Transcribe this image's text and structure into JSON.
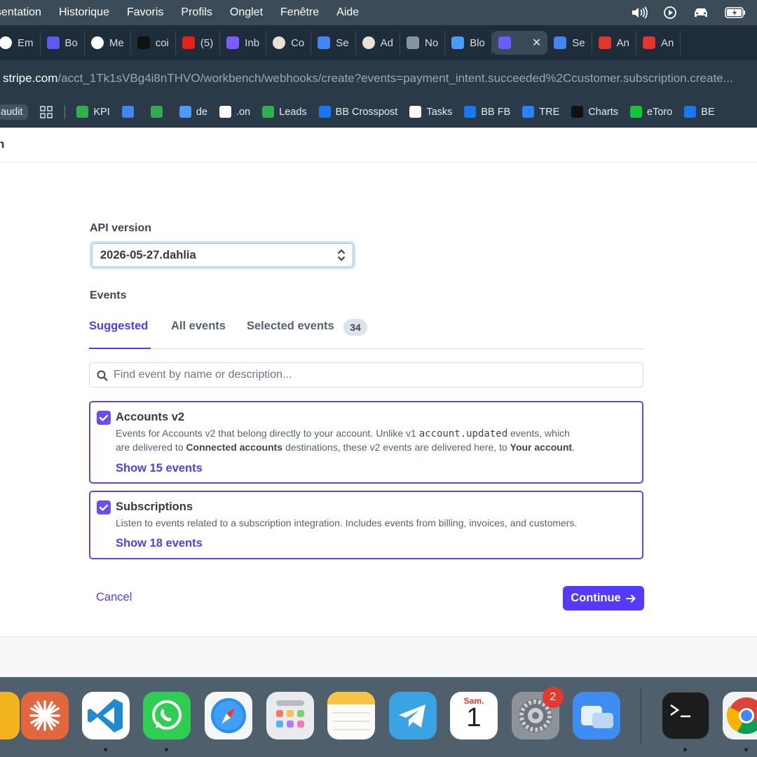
{
  "menubar": {
    "items": [
      "sentation",
      "Historique",
      "Favoris",
      "Profils",
      "Onglet",
      "Fenêtre",
      "Aide"
    ]
  },
  "tabs": [
    {
      "label": "Em",
      "color": "#ffffff"
    },
    {
      "label": "Bo",
      "color": "#5b5bf0"
    },
    {
      "label": "Me",
      "color": "#ffffff"
    },
    {
      "label": "coi",
      "color": "#111111"
    },
    {
      "label": "(5)",
      "color": "#e62117"
    },
    {
      "label": "Inb",
      "color": "#7c5cff"
    },
    {
      "label": "Co",
      "color": "#e9e2d0"
    },
    {
      "label": "Se",
      "color": "#4285f4"
    },
    {
      "label": "Ad",
      "color": "#e9e2d0"
    },
    {
      "label": "No",
      "color": "#8795a1"
    },
    {
      "label": "Blo",
      "color": "#4c9aff"
    },
    {
      "label": "",
      "color": "#6b5cff",
      "active": true
    },
    {
      "label": "Se",
      "color": "#4285f4"
    },
    {
      "label": "An",
      "color": "#e2362c"
    },
    {
      "label": "An",
      "color": "#e2362c"
    }
  ],
  "url": {
    "host": "stripe.com",
    "path": "/acct_1Tk1sVBg4i8nTHVO/workbench/webhooks/create?events=payment_intent.succeeded%2Ccustomer.subscription.create..."
  },
  "bookmarks": [
    {
      "label": "audit",
      "color": "#44535f"
    },
    {
      "label": "KPI",
      "color": "#2fb04d"
    },
    {
      "label": "",
      "color": "#4285f4"
    },
    {
      "label": "",
      "color": "#34a853"
    },
    {
      "label": "de",
      "color": "#4c9aff"
    },
    {
      "label": ".on",
      "color": "#ffffff"
    },
    {
      "label": "Leads",
      "color": "#2fb04d"
    },
    {
      "label": "BB Crosspost",
      "color": "#1877f2"
    },
    {
      "label": "Tasks",
      "color": "#ffffff"
    },
    {
      "label": "BB FB",
      "color": "#1877f2"
    },
    {
      "label": "TRE",
      "color": "#2684ff"
    },
    {
      "label": "Charts",
      "color": "#111111"
    },
    {
      "label": "eToro",
      "color": "#13c636"
    },
    {
      "label": "BE",
      "color": "#1877f2"
    }
  ],
  "page_header": {
    "title_fragment": "n"
  },
  "form": {
    "api_version_label": "API version",
    "api_version_value": "2026-05-27.dahlia",
    "events_label": "Events",
    "tabs": {
      "suggested": "Suggested",
      "all": "All events",
      "selected": "Selected events",
      "selected_count": "34"
    },
    "search_placeholder": "Find event by name or description...",
    "cards": [
      {
        "title": "Accounts v2",
        "desc_1": "Events for Accounts v2 that belong directly to your account. Unlike v1 ",
        "desc_code": "account.updated",
        "desc_2": " events, which",
        "desc_3": "are delivered to ",
        "desc_bold_1": "Connected accounts",
        "desc_4": " destinations, these v2 events are delivered here, to ",
        "desc_bold_2": "Your account",
        "desc_5": ".",
        "link": "Show 15 events"
      },
      {
        "title": "Subscriptions",
        "desc": "Listen to events related to a subscription integration. Includes events from billing, invoices, and customers.",
        "link": "Show 18 events"
      }
    ],
    "cancel": "Cancel",
    "continue": "Continue"
  },
  "dock": {
    "calendar_month": "Sam.",
    "calendar_day": "1",
    "settings_badge": "2"
  },
  "colors": {
    "accent": "#533afd",
    "card_border": "#6445e0"
  }
}
